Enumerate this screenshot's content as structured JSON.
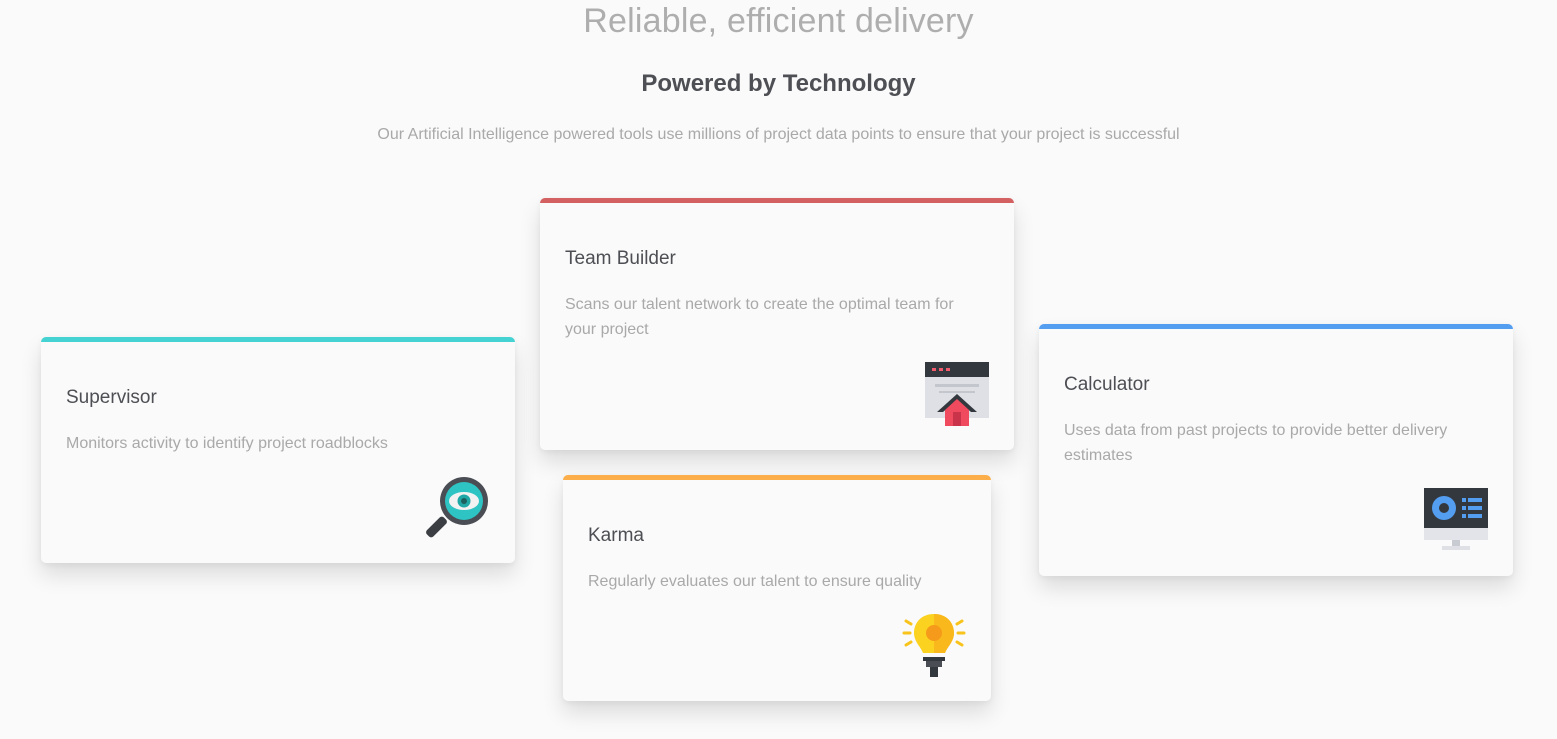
{
  "header": {
    "tagline": "Reliable, efficient delivery",
    "title": "Powered by Technology",
    "subtitle": "Our Artificial Intelligence powered tools use millions of project data points to ensure that your project is successful"
  },
  "cards": {
    "supervisor": {
      "title": "Supervisor",
      "description": "Monitors activity to identify project roadblocks",
      "accent": "#44d3d2",
      "icon": "magnifier-eye-icon"
    },
    "team_builder": {
      "title": "Team Builder",
      "description": "Scans our talent network to create the optimal team for your project",
      "accent": "#d46161",
      "icon": "browser-upload-icon"
    },
    "karma": {
      "title": "Karma",
      "description": "Regularly evaluates our talent to ensure quality",
      "accent": "#fcae4a",
      "icon": "lightbulb-icon"
    },
    "calculator": {
      "title": "Calculator",
      "description": "Uses data from past projects to provide better delivery estimates",
      "accent": "#549ef2",
      "icon": "monitor-dashboard-icon"
    }
  }
}
